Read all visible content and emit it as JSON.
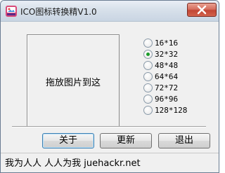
{
  "window": {
    "title": "ICO图标转换精V1.0",
    "icon": "ico-app-icon",
    "close_icon": "close-icon"
  },
  "drop_area": {
    "text": "拖放图片到这"
  },
  "sizes": {
    "options": [
      "16*16",
      "32*32",
      "48*48",
      "64*64",
      "72*72",
      "96*96",
      "128*128"
    ],
    "selected": "32*32"
  },
  "buttons": {
    "about": "关于",
    "update": "更新",
    "exit": "退出"
  },
  "status": {
    "text": "我为人人 人人为我 juehackr.net"
  },
  "colors": {
    "close_button": "#c94a38",
    "radio_selected": "#1b9c2b",
    "titlebar": "#d7e0ea"
  }
}
